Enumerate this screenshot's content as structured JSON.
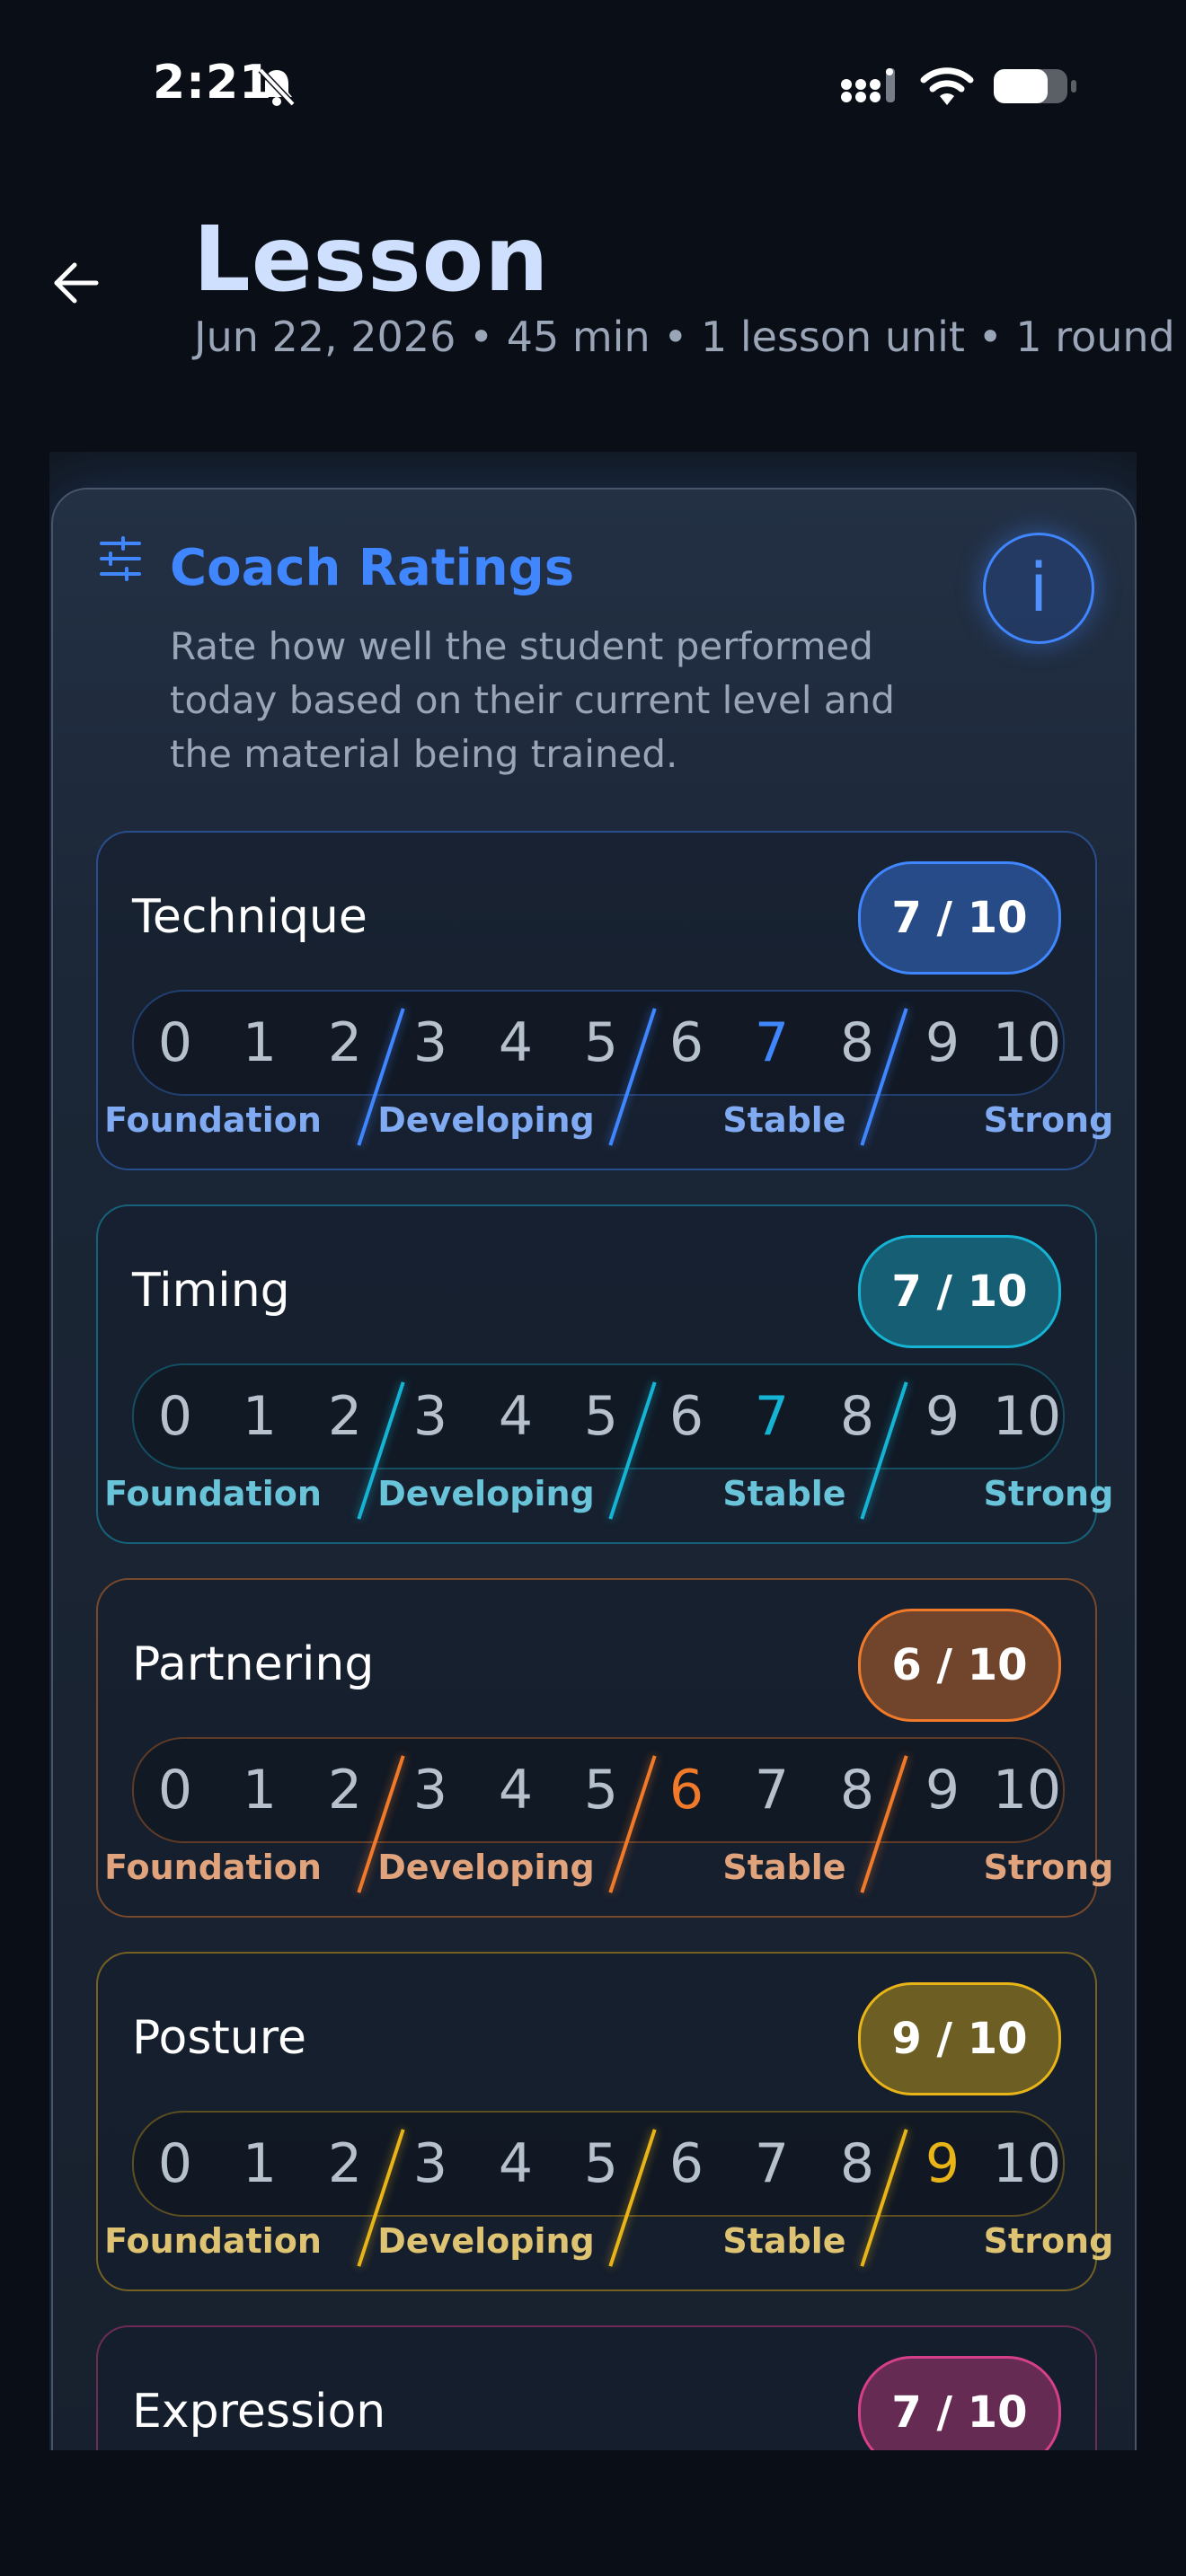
{
  "status_bar": {
    "time": "2:21",
    "icons": [
      "bell-slash-icon",
      "signal-icon",
      "wifi-icon",
      "battery-icon"
    ]
  },
  "header": {
    "title": "Lesson",
    "subtitle": "Jun 22, 2026 • 45 min • 1 lesson unit • 1 round",
    "back_icon": "arrow-left-icon"
  },
  "coach_ratings": {
    "title": "Coach Ratings",
    "description": "Rate how well the student performed today based on their current level and the material being trained.",
    "info_label": "i",
    "scale_numbers": [
      "0",
      "1",
      "2",
      "3",
      "4",
      "5",
      "6",
      "7",
      "8",
      "9",
      "10"
    ],
    "bands": [
      "Foundation",
      "Developing",
      "Stable",
      "Strong"
    ],
    "items": [
      {
        "name": "Technique",
        "value": 7,
        "display": "7 / 10",
        "color": "#3f86ff"
      },
      {
        "name": "Timing",
        "value": 7,
        "display": "7 / 10",
        "color": "#16b4d4"
      },
      {
        "name": "Partnering",
        "value": 6,
        "display": "6 / 10",
        "color": "#f07a2a"
      },
      {
        "name": "Posture",
        "value": 9,
        "display": "9 / 10",
        "color": "#e8b418"
      },
      {
        "name": "Expression",
        "value": 7,
        "display": "7 / 10",
        "color": "#d63f8a"
      }
    ]
  }
}
